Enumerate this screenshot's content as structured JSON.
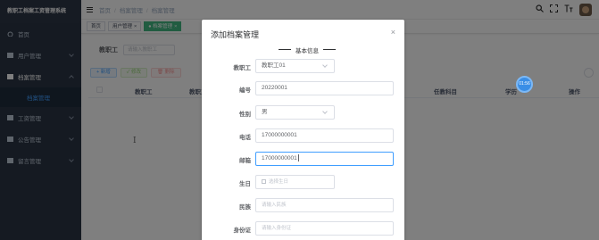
{
  "sidebar": {
    "app_title": "教职工档案工资管理系统",
    "items": [
      {
        "label": "首页",
        "icon": "dashboard-icon"
      },
      {
        "label": "用户管理",
        "icon": "folder-icon"
      },
      {
        "label": "档案管理",
        "icon": "folder-icon"
      },
      {
        "label": "档案管理",
        "icon": "none",
        "sub": true
      },
      {
        "label": "工资管理",
        "icon": "folder-icon"
      },
      {
        "label": "公告管理",
        "icon": "folder-icon"
      },
      {
        "label": "留言管理",
        "icon": "folder-icon"
      }
    ]
  },
  "navbar": {
    "breadcrumb": [
      "首页",
      "档案管理",
      "档案管理"
    ],
    "icons": [
      "search-icon",
      "fullscreen-icon",
      "font-size-icon",
      "avatar"
    ]
  },
  "tags": [
    {
      "label": "首页"
    },
    {
      "label": "用户管理",
      "closable": true
    },
    {
      "label": "档案管理",
      "closable": true,
      "active": true
    }
  ],
  "filter": {
    "label": "教职工",
    "placeholder": "请输入教职工"
  },
  "toolbar": {
    "add": "+ 新增",
    "edit": "✓ 修改",
    "delete": "🗑 删除"
  },
  "table": {
    "headers": [
      "教职工",
      "教职工",
      "任教科目",
      "学历",
      "操作"
    ]
  },
  "dialog": {
    "title": "添加档案管理",
    "close": "×",
    "section": "基本信息",
    "fields": [
      {
        "label": "教职工",
        "value": "教职工01",
        "type": "select"
      },
      {
        "label": "编号",
        "value": "20220001",
        "type": "input"
      },
      {
        "label": "性别",
        "value": "男",
        "type": "select"
      },
      {
        "label": "电话",
        "value": "17000000001",
        "type": "input"
      },
      {
        "label": "邮箱",
        "value": "17000000001",
        "type": "input",
        "focused": true
      },
      {
        "label": "生日",
        "placeholder": "选择生日",
        "type": "date"
      },
      {
        "label": "民族",
        "placeholder": "请输入民族",
        "type": "input"
      },
      {
        "label": "身份证",
        "placeholder": "请输入身份证",
        "type": "input"
      }
    ]
  },
  "timer_badge": "01:56",
  "colors": {
    "sidebar_bg": "#2b3444",
    "active_tag": "#42b983",
    "primary": "#409eff"
  }
}
